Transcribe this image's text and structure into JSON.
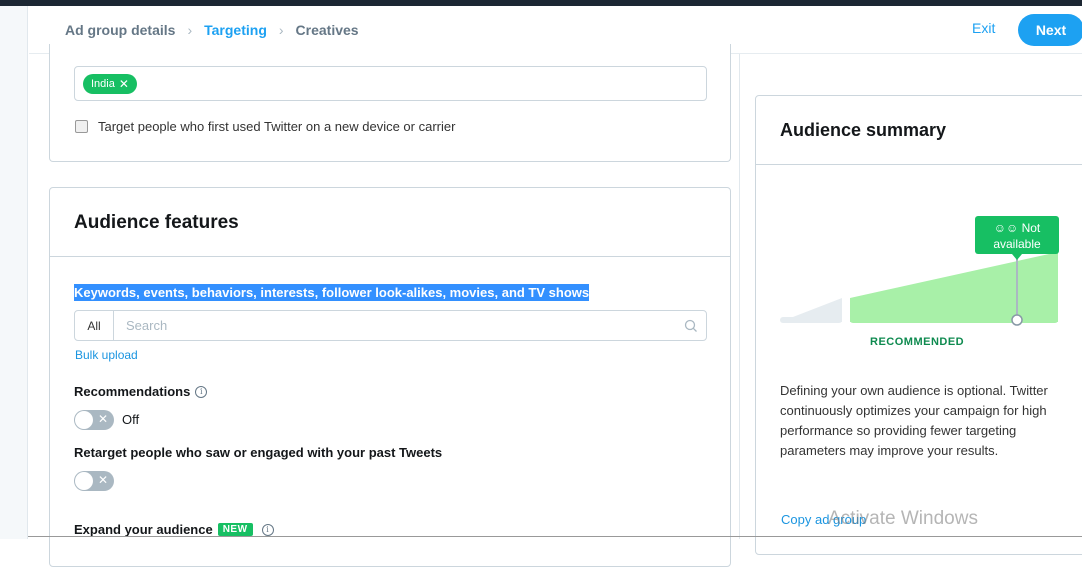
{
  "header": {
    "breadcrumbs": [
      {
        "label": "Ad group details",
        "active": false
      },
      {
        "label": "Targeting",
        "active": true
      },
      {
        "label": "Creatives",
        "active": false
      }
    ],
    "separator_icon": "chevron-right-icon",
    "exit_label": "Exit",
    "next_label": "Next"
  },
  "location": {
    "tags": [
      {
        "label": "India",
        "remove_icon": "close-icon"
      }
    ],
    "new_device_checkbox": {
      "label": "Target people who first used Twitter on a new device or carrier",
      "checked": false
    }
  },
  "audience_features": {
    "title": "Audience features",
    "keywords_label": "Keywords, events, behaviors, interests, follower look-alikes, movies, and TV shows",
    "search": {
      "filter": "All",
      "placeholder": "Search",
      "icon": "search-icon"
    },
    "bulk_upload": "Bulk upload",
    "recommendations": {
      "label": "Recommendations",
      "toggle_on": false,
      "state_label": "Off"
    },
    "retarget": {
      "label": "Retarget people who saw or engaged with your past Tweets",
      "toggle_on": false
    },
    "expand": {
      "label": "Expand your audience",
      "badge": "NEW"
    }
  },
  "audience_summary": {
    "title": "Audience summary",
    "tooltip": {
      "icon": "people-icon",
      "label": "Not available"
    },
    "zone_label": "RECOMMENDED",
    "description": "Defining your own audience is optional. Twitter continuously optimizes your campaign for high performance so providing fewer targeting parameters may improve your results.",
    "copy_link": "Copy ad group",
    "colors": {
      "recommended": "#a8f0a8",
      "tooltip": "#17bf63",
      "inactive": "#e6ecf0"
    }
  },
  "overlay": {
    "watermark": "Activate Windows"
  }
}
